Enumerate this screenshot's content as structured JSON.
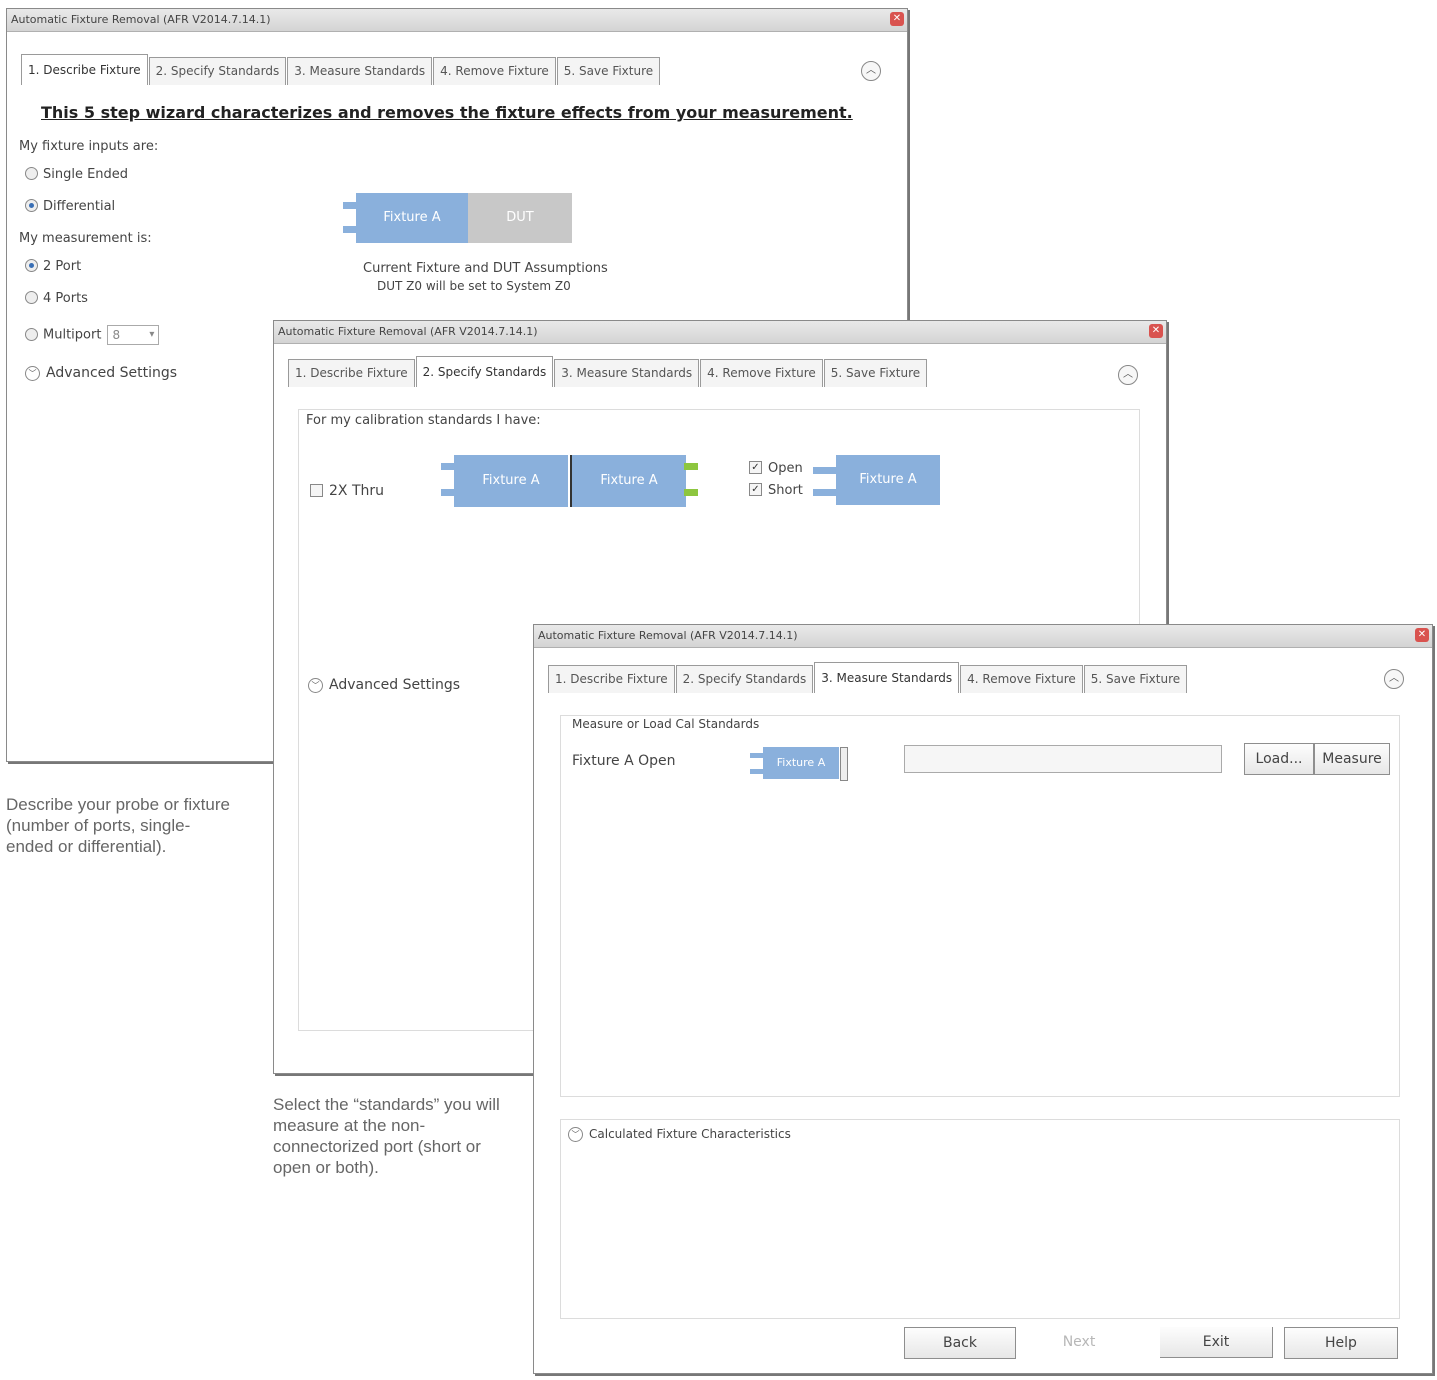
{
  "window_title": "Automatic Fixture Removal (AFR V2014.7.14.1)",
  "tabs": [
    "1. Describe Fixture",
    "2. Specify Standards",
    "3. Measure Standards",
    "4. Remove Fixture",
    "5. Save Fixture"
  ],
  "win1": {
    "headline": "This 5 step wizard characterizes and removes the fixture effects from your measurement.",
    "inputs_label": "My fixture inputs are:",
    "opt_single": "Single Ended",
    "opt_diff": "Differential",
    "measurement_label": "My measurement is:",
    "opt_2port": "2 Port",
    "opt_4port": "4 Ports",
    "opt_multiport": "Multiport",
    "multiport_value": "8",
    "advanced": "Advanced Settings",
    "block_fixture": "Fixture A",
    "block_dut": "DUT",
    "assumptions_line1": "Current Fixture and DUT Assumptions",
    "assumptions_line2": "DUT Z0 will be set to System Z0"
  },
  "win2": {
    "cal_label": "For my calibration standards I have:",
    "thru_label": "2X Thru",
    "block_a": "Fixture A",
    "block_b": "Fixture A",
    "open_label": "Open",
    "short_label": "Short",
    "block_c": "Fixture A",
    "advanced": "Advanced Settings"
  },
  "win3": {
    "section_label": "Measure or Load Cal Standards",
    "row_label": "Fixture A Open",
    "block": "Fixture A",
    "file_value": "",
    "load_button": "Load...",
    "measure_button": "Measure",
    "calc_label": "Calculated Fixture Characteristics",
    "back": "Back",
    "next": "Next",
    "exit": "Exit",
    "help": "Help"
  },
  "captions": {
    "c1": "Describe your probe or fixture (number of ports, single-ended or differential).",
    "c2": "Select the “standards” you will measure at the non-connectorized port (short or open or both)."
  }
}
